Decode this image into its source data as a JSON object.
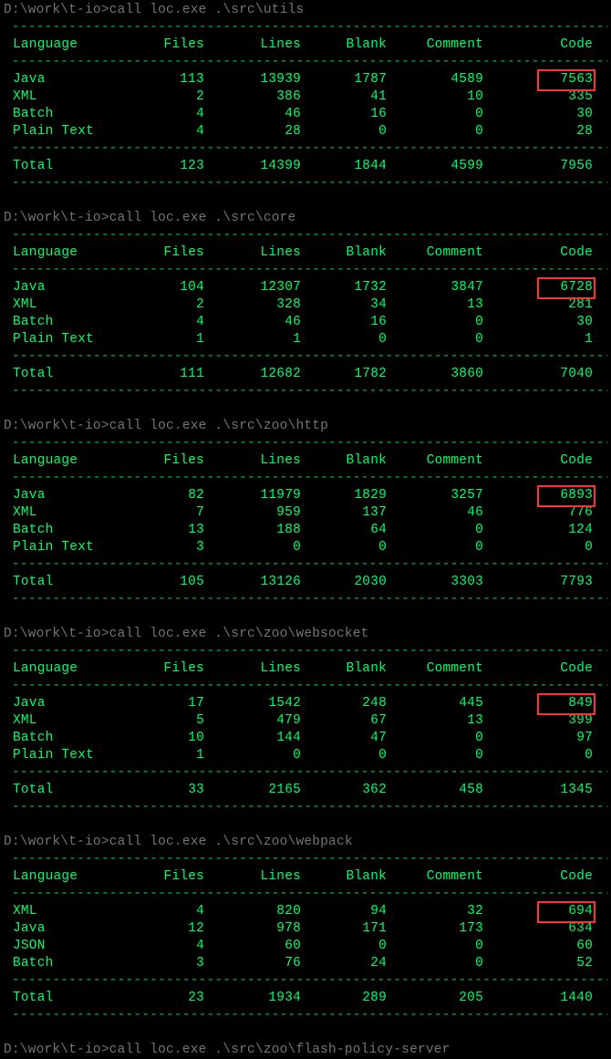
{
  "prompts": [
    {
      "prompt": "D:\\work\\t-io>",
      "cmd": "call loc.exe .\\src\\utils"
    },
    {
      "prompt": "D:\\work\\t-io>",
      "cmd": "call loc.exe .\\src\\core"
    },
    {
      "prompt": "D:\\work\\t-io>",
      "cmd": "call loc.exe .\\src\\zoo\\http"
    },
    {
      "prompt": "D:\\work\\t-io>",
      "cmd": "call loc.exe .\\src\\zoo\\websocket"
    },
    {
      "prompt": "D:\\work\\t-io>",
      "cmd": "call loc.exe .\\src\\zoo\\webpack"
    },
    {
      "prompt": "D:\\work\\t-io>",
      "cmd": "call loc.exe .\\src\\zoo\\flash-policy-server"
    }
  ],
  "headers": [
    "Language",
    "Files",
    "Lines",
    "Blank",
    "Comment",
    "Code"
  ],
  "sections": [
    {
      "rows": [
        {
          "c": [
            "Java",
            "113",
            "13939",
            "1787",
            "4589",
            "7563"
          ],
          "hi": true
        },
        {
          "c": [
            "XML",
            "2",
            "386",
            "41",
            "10",
            "335"
          ]
        },
        {
          "c": [
            "Batch",
            "4",
            "46",
            "16",
            "0",
            "30"
          ]
        },
        {
          "c": [
            "Plain Text",
            "4",
            "28",
            "0",
            "0",
            "28"
          ]
        }
      ],
      "total": [
        "Total",
        "123",
        "14399",
        "1844",
        "4599",
        "7956"
      ]
    },
    {
      "rows": [
        {
          "c": [
            "Java",
            "104",
            "12307",
            "1732",
            "3847",
            "6728"
          ],
          "hi": true
        },
        {
          "c": [
            "XML",
            "2",
            "328",
            "34",
            "13",
            "281"
          ]
        },
        {
          "c": [
            "Batch",
            "4",
            "46",
            "16",
            "0",
            "30"
          ]
        },
        {
          "c": [
            "Plain Text",
            "1",
            "1",
            "0",
            "0",
            "1"
          ]
        }
      ],
      "total": [
        "Total",
        "111",
        "12682",
        "1782",
        "3860",
        "7040"
      ]
    },
    {
      "rows": [
        {
          "c": [
            "Java",
            "82",
            "11979",
            "1829",
            "3257",
            "6893"
          ],
          "hi": true
        },
        {
          "c": [
            "XML",
            "7",
            "959",
            "137",
            "46",
            "776"
          ]
        },
        {
          "c": [
            "Batch",
            "13",
            "188",
            "64",
            "0",
            "124"
          ]
        },
        {
          "c": [
            "Plain Text",
            "3",
            "0",
            "0",
            "0",
            "0"
          ]
        }
      ],
      "total": [
        "Total",
        "105",
        "13126",
        "2030",
        "3303",
        "7793"
      ]
    },
    {
      "rows": [
        {
          "c": [
            "Java",
            "17",
            "1542",
            "248",
            "445",
            "849"
          ],
          "hi": true
        },
        {
          "c": [
            "XML",
            "5",
            "479",
            "67",
            "13",
            "399"
          ]
        },
        {
          "c": [
            "Batch",
            "10",
            "144",
            "47",
            "0",
            "97"
          ]
        },
        {
          "c": [
            "Plain Text",
            "1",
            "0",
            "0",
            "0",
            "0"
          ]
        }
      ],
      "total": [
        "Total",
        "33",
        "2165",
        "362",
        "458",
        "1345"
      ]
    },
    {
      "rows": [
        {
          "c": [
            "XML",
            "4",
            "820",
            "94",
            "32",
            "694"
          ],
          "hi": true
        },
        {
          "c": [
            "Java",
            "12",
            "978",
            "171",
            "173",
            "634"
          ]
        },
        {
          "c": [
            "JSON",
            "4",
            "60",
            "0",
            "0",
            "60"
          ]
        },
        {
          "c": [
            "Batch",
            "3",
            "76",
            "24",
            "0",
            "52"
          ]
        }
      ],
      "total": [
        "Total",
        "23",
        "1934",
        "289",
        "205",
        "1440"
      ]
    }
  ],
  "dashline": "--------------------------------------------------------------------------------"
}
